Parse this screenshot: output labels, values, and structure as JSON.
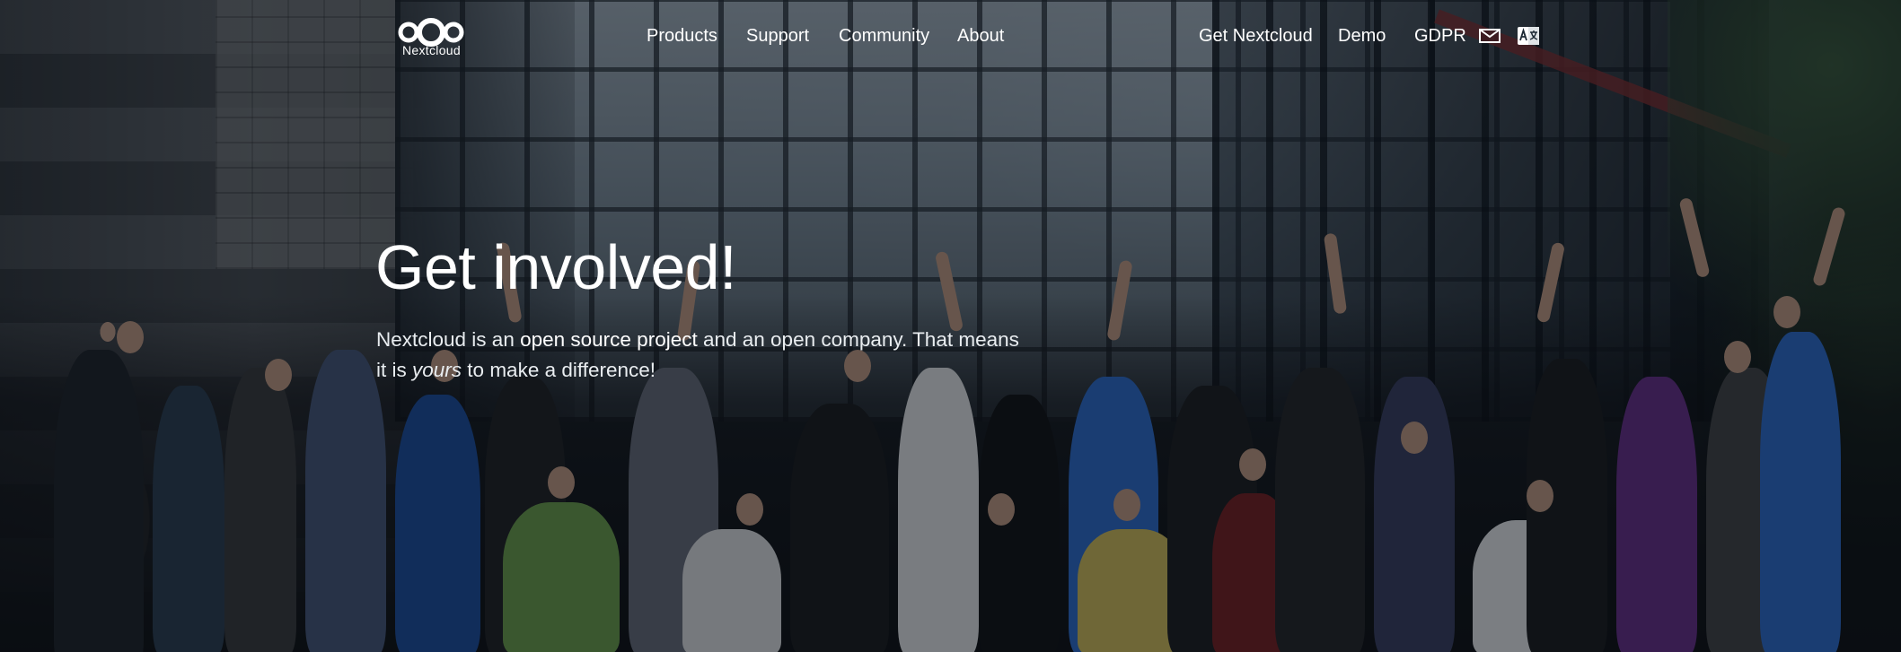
{
  "nav": {
    "logo_text": "Nextcloud",
    "left_links": [
      "Products",
      "Support",
      "Community",
      "About"
    ],
    "right_links": [
      "Get Nextcloud",
      "Demo",
      "GDPR"
    ],
    "icons": [
      "mail-icon",
      "translate-icon"
    ]
  },
  "hero": {
    "title": "Get involved!",
    "lead": {
      "part1": "Nextcloud is an ",
      "link": "open source project",
      "part2": " and an open company. That means it is ",
      "emph": "yours",
      "part3": " to make a difference!"
    }
  },
  "colors": {
    "text": "#ffffff",
    "overlay": "#06101a"
  }
}
